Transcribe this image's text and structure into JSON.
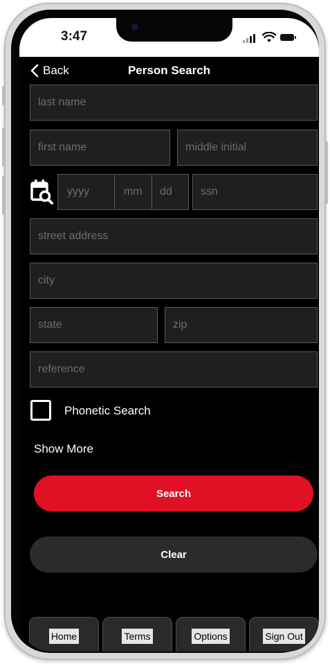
{
  "status_bar": {
    "time": "3:47"
  },
  "nav": {
    "back_label": "Back",
    "title": "Person Search"
  },
  "form": {
    "last_name_placeholder": "last name",
    "first_name_placeholder": "first name",
    "middle_initial_placeholder": "middle initial",
    "dob_year_placeholder": "yyyy",
    "dob_month_placeholder": "mm",
    "dob_day_placeholder": "dd",
    "ssn_placeholder": "ssn",
    "street_address_placeholder": "street address",
    "city_placeholder": "city",
    "state_placeholder": "state",
    "zip_placeholder": "zip",
    "reference_placeholder": "reference"
  },
  "phonetic_search": {
    "label": "Phonetic Search",
    "checked": false
  },
  "show_more_label": "Show More",
  "buttons": {
    "search_label": "Search",
    "clear_label": "Clear"
  },
  "tab_bar": {
    "home": "Home",
    "terms": "Terms",
    "options": "Options",
    "sign_out": "Sign Out"
  },
  "colors": {
    "accent": "#e01025",
    "background": "#000000",
    "field_bg": "#1f1f21",
    "field_border": "#5a5a5e"
  }
}
